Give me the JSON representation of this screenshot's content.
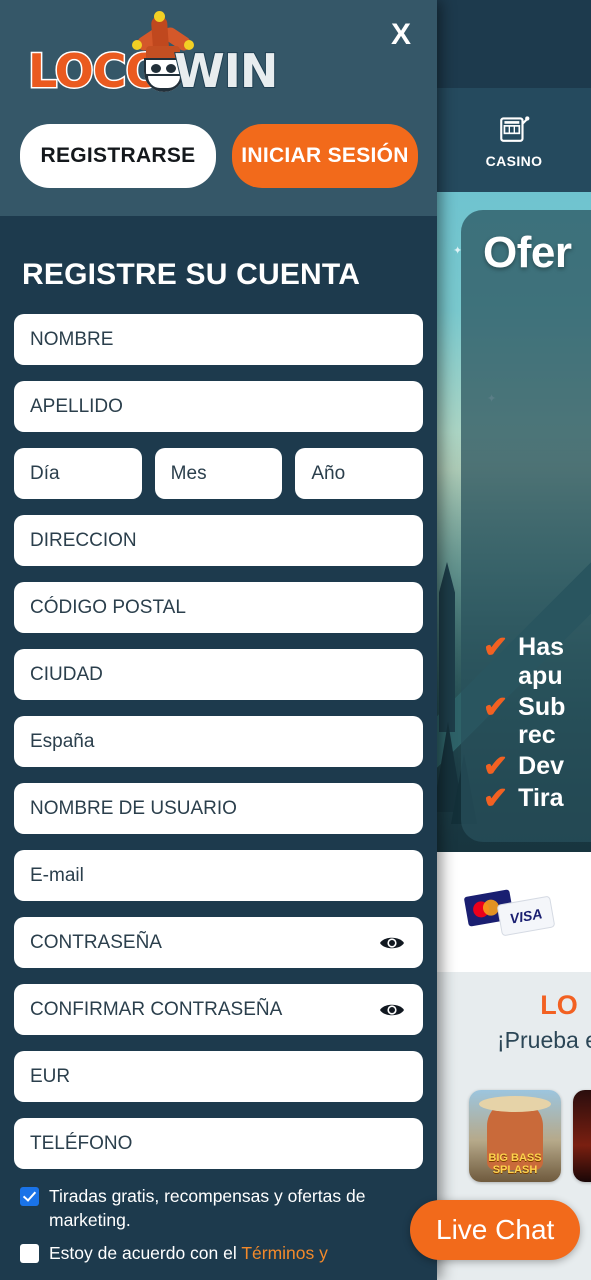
{
  "brand": {
    "name_part1": "LOCO",
    "name_part2": "WIN",
    "logo_icon": "jester-logo",
    "accent_orange": "#f26a1b",
    "panel_dark": "#1d3a4d",
    "panel_header": "#355768",
    "checkbox_blue": "#1a73e8"
  },
  "background_page": {
    "menu_icon": "hamburger-menu-icon",
    "logo_text": "LOC",
    "nav": [
      {
        "icon": "slot-machine-icon",
        "label": "CASINO"
      }
    ],
    "banner": {
      "title": "Ofer",
      "bullets": [
        {
          "icon": "check-icon",
          "lines": [
            "Has",
            "apu"
          ]
        },
        {
          "icon": "check-icon",
          "lines": [
            "Sub",
            "rec"
          ]
        },
        {
          "icon": "check-icon",
          "lines": [
            "Dev"
          ]
        },
        {
          "icon": "check-icon",
          "lines": [
            "Tira"
          ]
        }
      ]
    },
    "payments": {
      "mastercard_icon": "mastercard-icon",
      "visa_icon": "visa-icon",
      "visa_label": "VISA"
    },
    "promo": {
      "title": "LO",
      "subtitle": "¡Prueba es",
      "games": [
        {
          "label": "BIG BASS SPLASH"
        },
        {
          "label": ""
        }
      ]
    },
    "live_chat_label": "Live Chat"
  },
  "modal": {
    "close_icon": "close-icon",
    "close_label": "X",
    "buttons": {
      "register": "REGISTRARSE",
      "login": "INICIAR SESIÓN"
    },
    "form": {
      "title": "REGISTRE SU CUENTA",
      "fields": [
        {
          "name": "first-name",
          "label": "NOMBRE"
        },
        {
          "name": "last-name",
          "label": "APELLIDO"
        }
      ],
      "dob": [
        {
          "name": "day",
          "label": "Día"
        },
        {
          "name": "month",
          "label": "Mes"
        },
        {
          "name": "year",
          "label": "Año"
        }
      ],
      "fields2": [
        {
          "name": "address",
          "label": "DIRECCION"
        },
        {
          "name": "postal-code",
          "label": "CÓDIGO POSTAL"
        },
        {
          "name": "city",
          "label": "CIUDAD"
        },
        {
          "name": "country",
          "label": "España"
        },
        {
          "name": "username",
          "label": "NOMBRE DE USUARIO"
        },
        {
          "name": "email",
          "label": "E-mail"
        }
      ],
      "password_fields": [
        {
          "name": "password",
          "label": "CONTRASEÑA",
          "icon": "eye-icon"
        },
        {
          "name": "confirm-password",
          "label": "CONFIRMAR CONTRASEÑA",
          "icon": "eye-icon"
        }
      ],
      "fields3": [
        {
          "name": "currency",
          "label": "EUR"
        },
        {
          "name": "phone",
          "label": "TELÉFONO"
        }
      ],
      "checkboxes": [
        {
          "name": "marketing-consent",
          "checked": true,
          "text": "Tiradas gratis, recompensas y ofertas de marketing."
        },
        {
          "name": "terms-consent",
          "checked": false,
          "text_prefix": "Estoy de acuerdo con el ",
          "link_text": "Términos y"
        }
      ]
    }
  }
}
